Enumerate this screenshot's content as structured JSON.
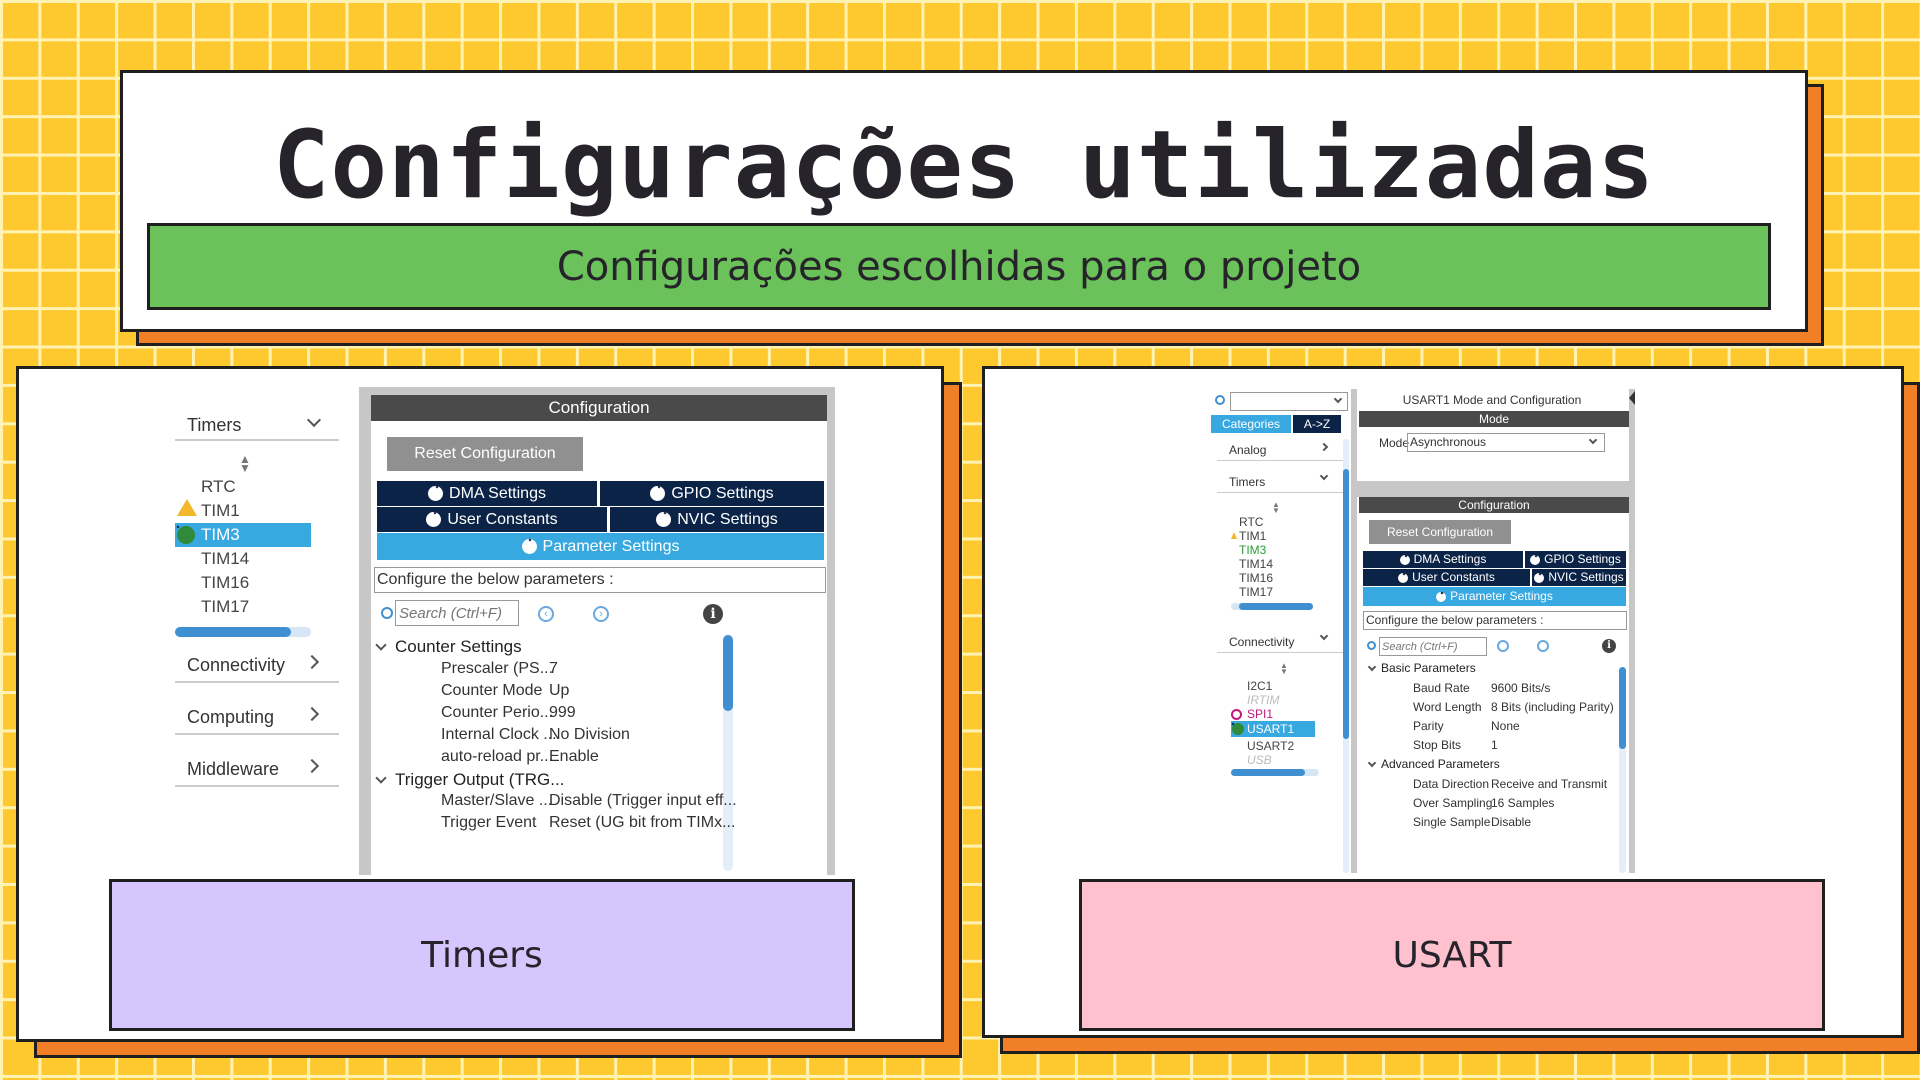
{
  "header": {
    "title": "Configurações utilizadas",
    "subtitle": "Configurações escolhidas para o projeto"
  },
  "colors": {
    "background": "#fec92f",
    "shadow": "#f07f27",
    "subtitle_bar": "#6bc15a",
    "timers_caption": "#d6c6fd",
    "usart_caption": "#ffc1cd",
    "ide_navy": "#0b2347",
    "ide_selected": "#38a8e0"
  },
  "timers_panel": {
    "caption": "Timers",
    "sidebar": {
      "category": "Timers",
      "items": [
        "RTC",
        "TIM1",
        "TIM3",
        "TIM14",
        "TIM16",
        "TIM17"
      ],
      "warning_item": "TIM1",
      "selected_item": "TIM3",
      "other_categories": [
        "Connectivity",
        "Computing",
        "Middleware"
      ]
    },
    "config": {
      "header": "Configuration",
      "reset_label": "Reset Configuration",
      "tabs": [
        "DMA Settings",
        "GPIO Settings",
        "User Constants",
        "NVIC Settings",
        "Parameter Settings"
      ],
      "configure_label": "Configure the below parameters :",
      "search_placeholder": "Search (Ctrl+F)",
      "groups": [
        {
          "name": "Counter Settings",
          "params": [
            {
              "name": "Prescaler (PS...",
              "value": "7"
            },
            {
              "name": "Counter Mode",
              "value": "Up"
            },
            {
              "name": "Counter Perio...",
              "value": "999"
            },
            {
              "name": "Internal Clock ...",
              "value": "No Division"
            },
            {
              "name": "auto-reload pr...",
              "value": "Enable"
            }
          ]
        },
        {
          "name": "Trigger Output (TRG...",
          "params": [
            {
              "name": "Master/Slave ...",
              "value": "Disable (Trigger input eff..."
            },
            {
              "name": "Trigger Event",
              "value": "Reset (UG bit from TIMx..."
            }
          ]
        }
      ]
    }
  },
  "usart_panel": {
    "caption": "USART",
    "sidebar": {
      "tab_categories": "Categories",
      "tab_az": "A->Z",
      "analog": "Analog",
      "timers_category": "Timers",
      "timer_items": [
        "RTC",
        "TIM1",
        "TIM3",
        "TIM14",
        "TIM16",
        "TIM17"
      ],
      "connectivity_category": "Connectivity",
      "connectivity_items": [
        "I2C1",
        "IRTIM",
        "SPI1",
        "USART1",
        "USART2",
        "USB"
      ],
      "selected_item": "USART1"
    },
    "mode_title": "USART1 Mode and Configuration",
    "mode_header": "Mode",
    "mode_label": "Mode",
    "mode_value": "Asynchronous",
    "config": {
      "header": "Configuration",
      "reset_label": "Reset Configuration",
      "tabs": [
        "DMA Settings",
        "GPIO Settings",
        "User Constants",
        "NVIC Settings",
        "Parameter Settings"
      ],
      "configure_label": "Configure the below parameters :",
      "search_placeholder": "Search (Ctrl+F)",
      "groups": [
        {
          "name": "Basic Parameters",
          "params": [
            {
              "name": "Baud Rate",
              "value": "9600 Bits/s"
            },
            {
              "name": "Word Length",
              "value": "8 Bits (including Parity)"
            },
            {
              "name": "Parity",
              "value": "None"
            },
            {
              "name": "Stop Bits",
              "value": "1"
            }
          ]
        },
        {
          "name": "Advanced Parameters",
          "params": [
            {
              "name": "Data Direction",
              "value": "Receive and Transmit"
            },
            {
              "name": "Over Sampling",
              "value": "16 Samples"
            },
            {
              "name": "Single Sample",
              "value": "Disable"
            }
          ]
        }
      ]
    }
  }
}
